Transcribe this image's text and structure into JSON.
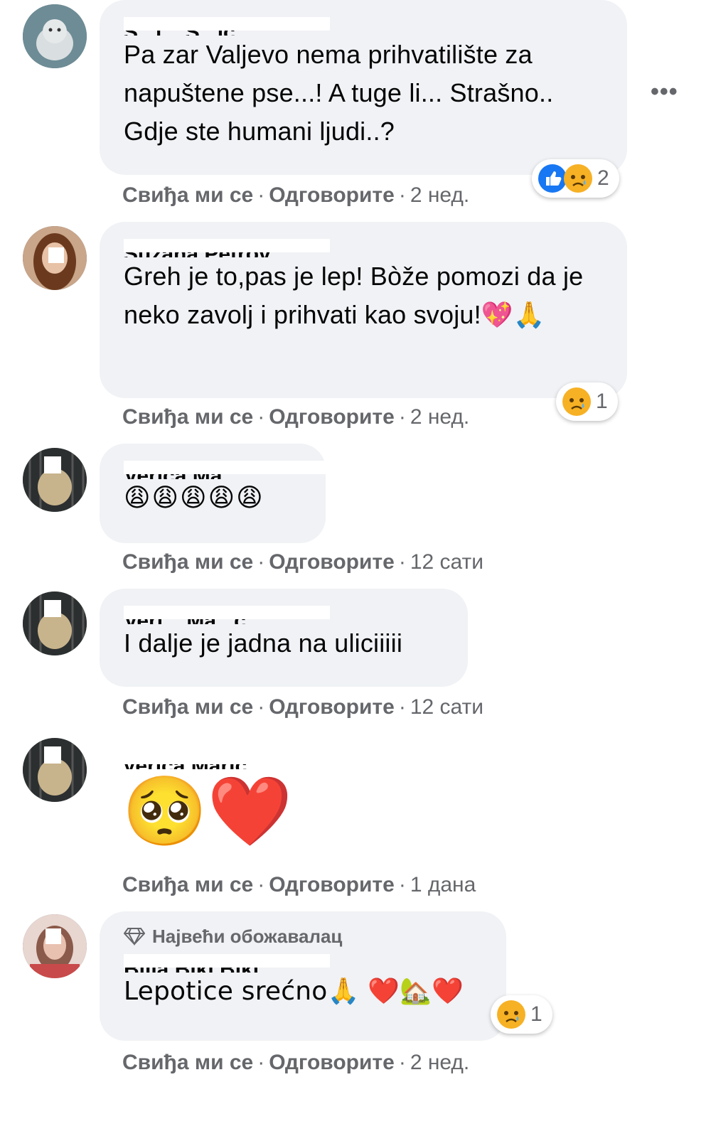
{
  "actions": {
    "like": "Свиђа ми се",
    "reply": "Одговорите",
    "separator": "·"
  },
  "more_label": "•••",
  "comments": [
    {
      "author": "S...i... S...ić",
      "text": "Pa zar Valjevo nema prihvatilište za napuštene pse...! A tuge li... Strašno.. Gdje ste humani ljudi..?",
      "time": "2 нед.",
      "reaction_count": "2",
      "reactions": [
        "like-icon",
        "sad-icon"
      ]
    },
    {
      "author": "Suzana Petrov...",
      "text": "Greh je to,pas je lep! Bòže pomozi da je neko zavolj i prihvati kao svoju!💖🙏",
      "time": "2 нед.",
      "reaction_count": "1",
      "reactions": [
        "sad-icon"
      ]
    },
    {
      "author": "Verica Ma...",
      "text": "😩😩😩😩😩",
      "time": "12 сати"
    },
    {
      "author": "Veri... Ma...ć",
      "text": "I dalje je jadna na uliciiiii",
      "time": "12 сати"
    },
    {
      "author": "Verica Marić",
      "text": "🥺❤️",
      "time": "1 дана"
    },
    {
      "badge": "Највећи обожавалац",
      "author": "Bilja Biki Biki",
      "text": "Lepotice srećno🙏 ❤️🏡❤️",
      "time": "2 нед.",
      "reaction_count": "1",
      "reactions": [
        "sad-icon"
      ]
    }
  ],
  "colors": {
    "bubble": "#f0f2f5",
    "meta": "#65676b",
    "like_blue": "#1877f2",
    "sad_yellow": "#f7b125"
  }
}
